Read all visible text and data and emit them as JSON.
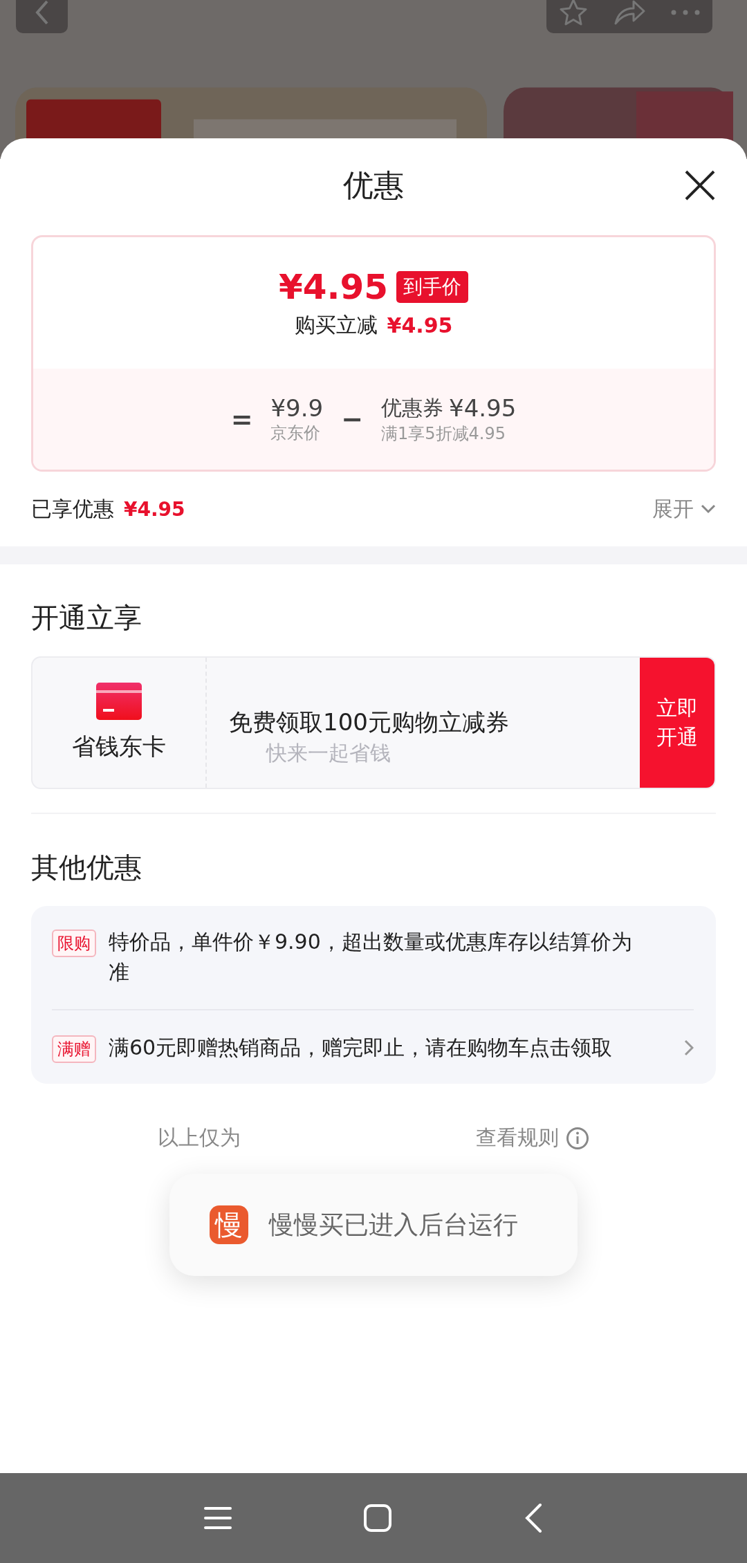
{
  "sheet": {
    "title": "优惠"
  },
  "price_card": {
    "price": "¥4.95",
    "price_tag": "到手价",
    "instant_label": "购买立减",
    "instant_amount": "¥4.95",
    "equals": "=",
    "original_price": "¥9.9",
    "original_label": "京东价",
    "minus": "−",
    "coupon_label": "优惠券",
    "coupon_amount": "¥4.95",
    "coupon_rule": "满1享5折减4.95"
  },
  "enjoyed": {
    "label": "已享优惠",
    "amount": "¥4.95",
    "expand": "展开"
  },
  "open_section": {
    "title": "开通立享",
    "card_name": "省钱东卡",
    "offer": "免费领取100元购物立减券",
    "slogan": "快来一起省钱",
    "button": [
      "立即",
      "开通"
    ]
  },
  "other_section": {
    "title": "其他优惠",
    "items": [
      {
        "tag": "限购",
        "text": "特价品，单件价￥9.90，超出数量或优惠库存以结算价为准",
        "has_arrow": false
      },
      {
        "tag": "满赠",
        "text": "满60元即赠热销商品，赠完即止，请在购物车点击领取",
        "has_arrow": true
      }
    ]
  },
  "disclaimer": {
    "left": "以上仅为",
    "right": "查看规则"
  },
  "toast": {
    "app_icon": "慢",
    "message": "慢慢买已进入后台运行"
  }
}
